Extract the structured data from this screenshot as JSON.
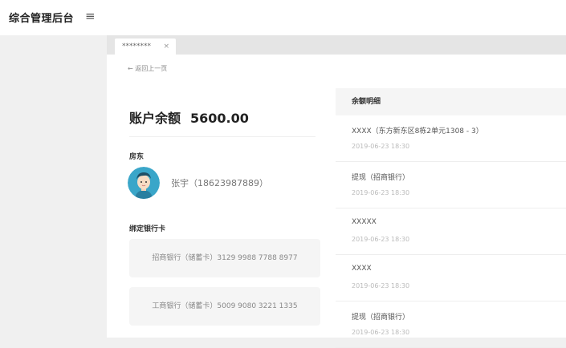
{
  "app": {
    "title": "综合管理后台",
    "menu_icon": "menu-icon"
  },
  "tab": {
    "label": "********",
    "close": "×"
  },
  "back": "← 返回上一页",
  "account": {
    "balance_label": "账户余额",
    "balance_value": "5600.00",
    "owner_label": "房东",
    "owner_name": "张宇（18623987889）",
    "cards_label": "绑定银行卡",
    "cards": [
      "招商银行（储蓄卡）3129 9988 7788 8977",
      "工商银行（储蓄卡）5009 9080 3221 1335"
    ]
  },
  "details": {
    "header": "余额明细",
    "records": [
      {
        "title": "XXXX（东方新东区8栋2单元1308 - 3）",
        "time": "2019-06-23 18:30"
      },
      {
        "title": "提现（招商银行）",
        "time": "2019-06-23 18:30"
      },
      {
        "title": "XXXXX",
        "time": "2019-06-23 18:30"
      },
      {
        "title": "XXXX",
        "time": "2019-06-23 18:30"
      },
      {
        "title": "提现（招商银行）",
        "time": "2019-06-23 18:30"
      }
    ]
  },
  "colors": {
    "background": "#f0f0f0",
    "panel": "#ffffff",
    "muted": "#f5f5f5",
    "avatar": "#3aa6c9"
  }
}
